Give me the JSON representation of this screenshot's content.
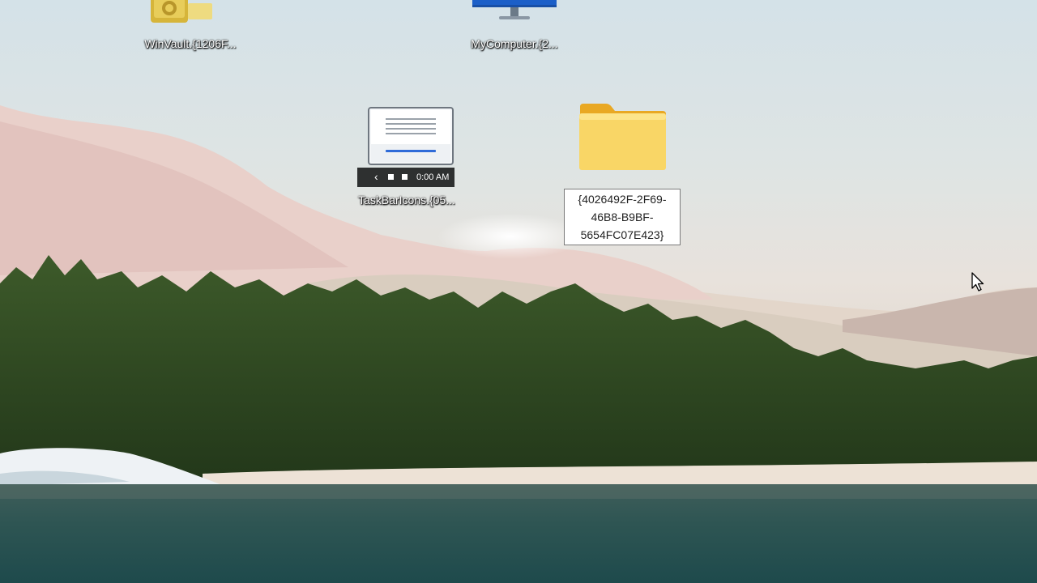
{
  "desktop": {
    "icons": [
      {
        "label": "WinVault.{1206F...",
        "icon": "vault-icon"
      },
      {
        "label": "MyComputer.{2...",
        "icon": "monitor-icon"
      },
      {
        "label": "TaskBarIcons.{05...",
        "icon": "taskbar-icon",
        "clock": "0:00 AM"
      },
      {
        "label": "{4026492F-2F69-46B8-B9BF-5654FC07E423}",
        "icon": "folder-icon",
        "renaming": true,
        "rename_lines": [
          "{4026492F-2F69-",
          "46B8-B9BF-",
          "5654FC07E423}"
        ]
      }
    ]
  },
  "colors": {
    "folder": "#f6c94d",
    "accent": "#2f6bd8",
    "taskbar": "#2e3030"
  }
}
